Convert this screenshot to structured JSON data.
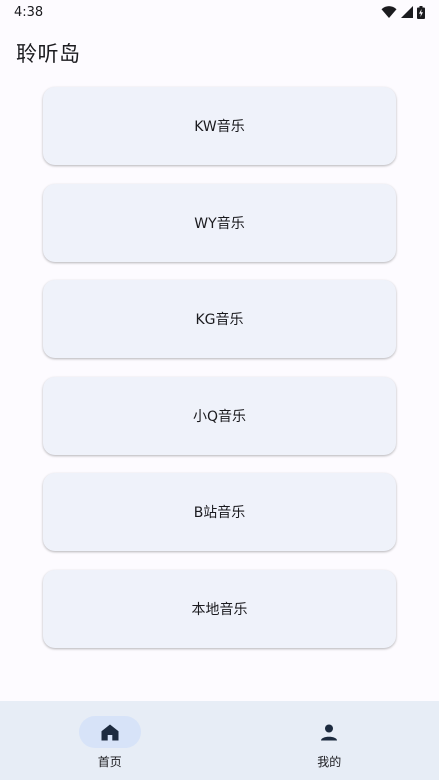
{
  "status_bar": {
    "time": "4:38",
    "icons": [
      "wifi-icon",
      "signal-icon",
      "battery-charging-icon"
    ]
  },
  "app": {
    "title": "聆听岛"
  },
  "sources": [
    {
      "label": "KW音乐"
    },
    {
      "label": "WY音乐"
    },
    {
      "label": "KG音乐"
    },
    {
      "label": "小Q音乐"
    },
    {
      "label": "B站音乐"
    },
    {
      "label": "本地音乐"
    }
  ],
  "bottom_nav": {
    "items": [
      {
        "label": "首页",
        "icon": "home-icon",
        "active": true
      },
      {
        "label": "我的",
        "icon": "person-icon",
        "active": false
      }
    ]
  },
  "colors": {
    "background": "#fdfbff",
    "card": "#eff2fa",
    "nav_background": "#e7edf6",
    "nav_active_pill": "#d7e3f8",
    "icon_dark": "#1d2b3f"
  }
}
